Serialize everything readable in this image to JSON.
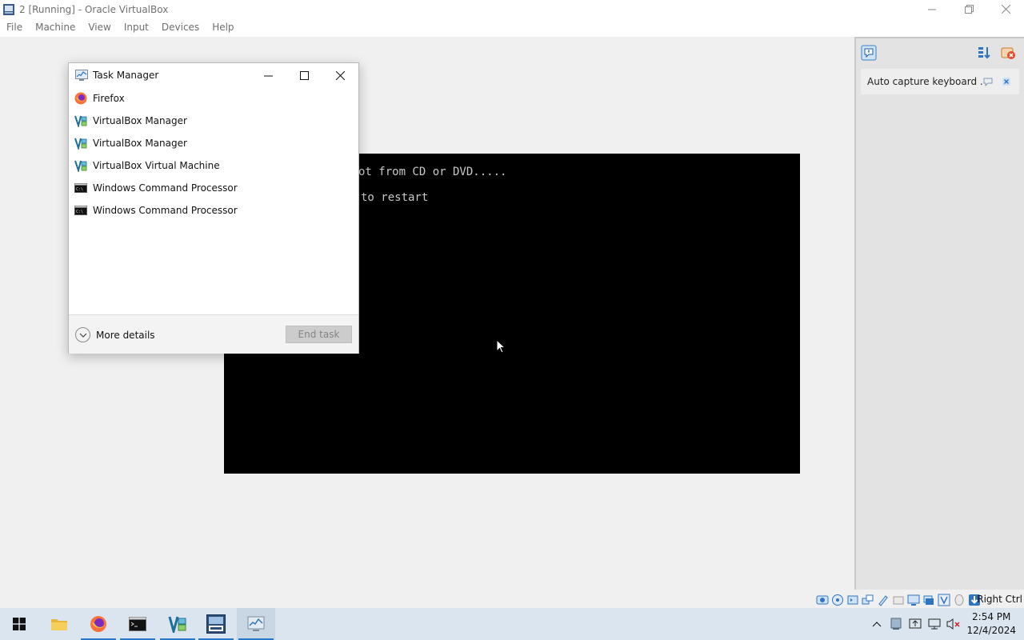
{
  "window": {
    "title": "2 [Running] - Oracle VirtualBox",
    "controls": [
      "minimize",
      "restore",
      "close"
    ]
  },
  "menubar": {
    "items": [
      "File",
      "Machine",
      "View",
      "Input",
      "Devices",
      "Help"
    ]
  },
  "vm_screen": {
    "lines": [
      "ot from CD or DVD.....",
      "to restart"
    ]
  },
  "side_panel": {
    "notification": "Auto capture keyboard ..."
  },
  "statusbar": {
    "host_key": "Right Ctrl"
  },
  "task_manager": {
    "title": "Task Manager",
    "apps": [
      {
        "label": "Firefox",
        "icon": "firefox-icon"
      },
      {
        "label": "VirtualBox Manager",
        "icon": "virtualbox-icon"
      },
      {
        "label": "VirtualBox Manager",
        "icon": "virtualbox-icon"
      },
      {
        "label": "VirtualBox Virtual Machine",
        "icon": "virtualbox-icon"
      },
      {
        "label": "Windows Command Processor",
        "icon": "cmd-icon"
      },
      {
        "label": "Windows Command Processor",
        "icon": "cmd-icon"
      }
    ],
    "more_details": "More details",
    "end_task": "End task"
  },
  "taskbar": {
    "buttons": [
      "start-icon",
      "file-explorer-icon",
      "firefox-icon",
      "cmd-icon",
      "virtualbox-icon",
      "vm-2008-icon",
      "task-manager-icon"
    ],
    "clock": {
      "time": "2:54 PM",
      "date": "12/4/2024"
    }
  },
  "colors": {
    "taskbar": "#dbe5ef",
    "accent": "#2a78c8",
    "vm_screen": "#000000",
    "vm_text": "#c8c8c8"
  }
}
